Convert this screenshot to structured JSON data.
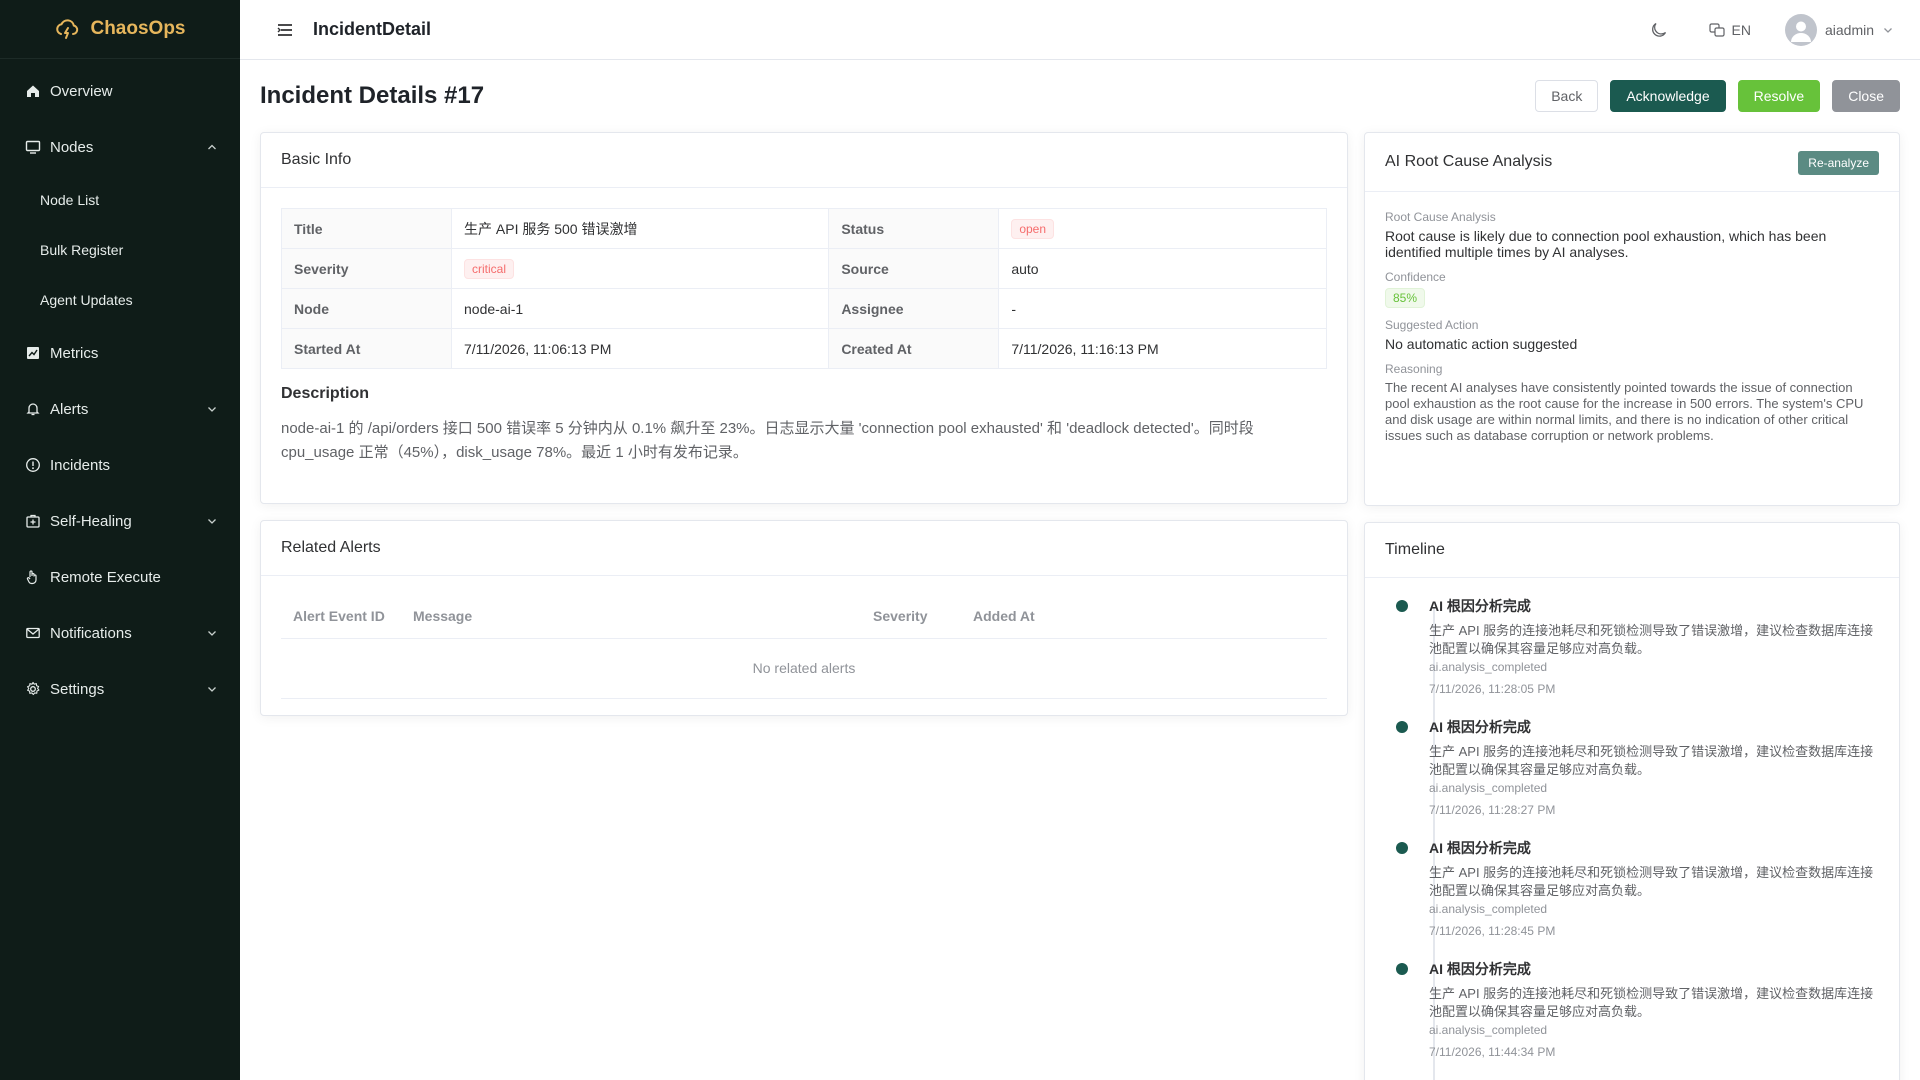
{
  "brand": {
    "name": "ChaosOps"
  },
  "sidebar": {
    "items": [
      {
        "label": "Overview",
        "icon": "home-icon"
      },
      {
        "label": "Nodes",
        "icon": "monitor-icon",
        "expanded": true,
        "children": [
          {
            "label": "Node List"
          },
          {
            "label": "Bulk Register"
          },
          {
            "label": "Agent Updates"
          }
        ]
      },
      {
        "label": "Metrics",
        "icon": "chart-icon"
      },
      {
        "label": "Alerts",
        "icon": "bell-icon",
        "expanded": false
      },
      {
        "label": "Incidents",
        "icon": "info-circle-icon"
      },
      {
        "label": "Self-Healing",
        "icon": "first-aid-icon",
        "expanded": false
      },
      {
        "label": "Remote Execute",
        "icon": "hand-icon"
      },
      {
        "label": "Notifications",
        "icon": "mail-icon",
        "expanded": false
      },
      {
        "label": "Settings",
        "icon": "gear-icon",
        "expanded": false
      }
    ]
  },
  "header": {
    "title": "IncidentDetail",
    "lang": "EN",
    "user": "aiadmin"
  },
  "page": {
    "title": "Incident Details #17",
    "actions": {
      "back": "Back",
      "acknowledge": "Acknowledge",
      "resolve": "Resolve",
      "close": "Close"
    }
  },
  "basic_info": {
    "header": "Basic Info",
    "rows": [
      {
        "l1": "Title",
        "v1": "生产 API 服务 500 错误激增",
        "l2": "Status",
        "v2": "open"
      },
      {
        "l1": "Severity",
        "v1": "critical",
        "l2": "Source",
        "v2": "auto"
      },
      {
        "l1": "Node",
        "v1": "node-ai-1",
        "l2": "Assignee",
        "v2": "-"
      },
      {
        "l1": "Started At",
        "v1": "7/11/2026, 11:06:13 PM",
        "l2": "Created At",
        "v2": "7/11/2026, 11:16:13 PM"
      }
    ],
    "description_title": "Description",
    "description": "node-ai-1 的 /api/orders 接口 500 错误率 5 分钟内从 0.1% 飙升至 23%。日志显示大量 'connection pool exhausted' 和 'deadlock detected'。同时段 cpu_usage 正常（45%），disk_usage 78%。最近 1 小时有发布记录。"
  },
  "related_alerts": {
    "header": "Related Alerts",
    "columns": [
      "Alert Event ID",
      "Message",
      "Severity",
      "Added At"
    ],
    "empty": "No related alerts"
  },
  "ai": {
    "header": "AI Root Cause Analysis",
    "reanalyze": "Re-analyze",
    "root_cause_label": "Root Cause Analysis",
    "root_cause": "Root cause is likely due to connection pool exhaustion, which has been identified multiple times by AI analyses.",
    "confidence_label": "Confidence",
    "confidence": "85%",
    "action_label": "Suggested Action",
    "action": "No automatic action suggested",
    "reasoning_label": "Reasoning",
    "reasoning": "The recent AI analyses have consistently pointed towards the issue of connection pool exhaustion as the root cause for the increase in 500 errors. The system's CPU and disk usage are within normal limits, and there is no indication of other critical issues such as database corruption or network problems."
  },
  "timeline": {
    "header": "Timeline",
    "items": [
      {
        "title": "AI 根因分析完成",
        "content": "生产 API 服务的连接池耗尽和死锁检测导致了错误激增，建议检查数据库连接池配置以确保其容量足够应对高负载。",
        "type": "ai.analysis_completed",
        "time": "7/11/2026, 11:28:05 PM"
      },
      {
        "title": "AI 根因分析完成",
        "content": "生产 API 服务的连接池耗尽和死锁检测导致了错误激增，建议检查数据库连接池配置以确保其容量足够应对高负载。",
        "type": "ai.analysis_completed",
        "time": "7/11/2026, 11:28:27 PM"
      },
      {
        "title": "AI 根因分析完成",
        "content": "生产 API 服务的连接池耗尽和死锁检测导致了错误激增，建议检查数据库连接池配置以确保其容量足够应对高负载。",
        "type": "ai.analysis_completed",
        "time": "7/11/2026, 11:28:45 PM"
      },
      {
        "title": "AI 根因分析完成",
        "content": "生产 API 服务的连接池耗尽和死锁检测导致了错误激增，建议检查数据库连接池配置以确保其容量足够应对高负载。",
        "type": "ai.analysis_completed",
        "time": "7/11/2026, 11:44:34 PM"
      }
    ]
  },
  "colors": {
    "sidebar_bg": "#0f1c18",
    "brand": "#e6b65c",
    "primary": "#1b5a50",
    "success": "#67c23a",
    "danger": "#f56c6c"
  }
}
